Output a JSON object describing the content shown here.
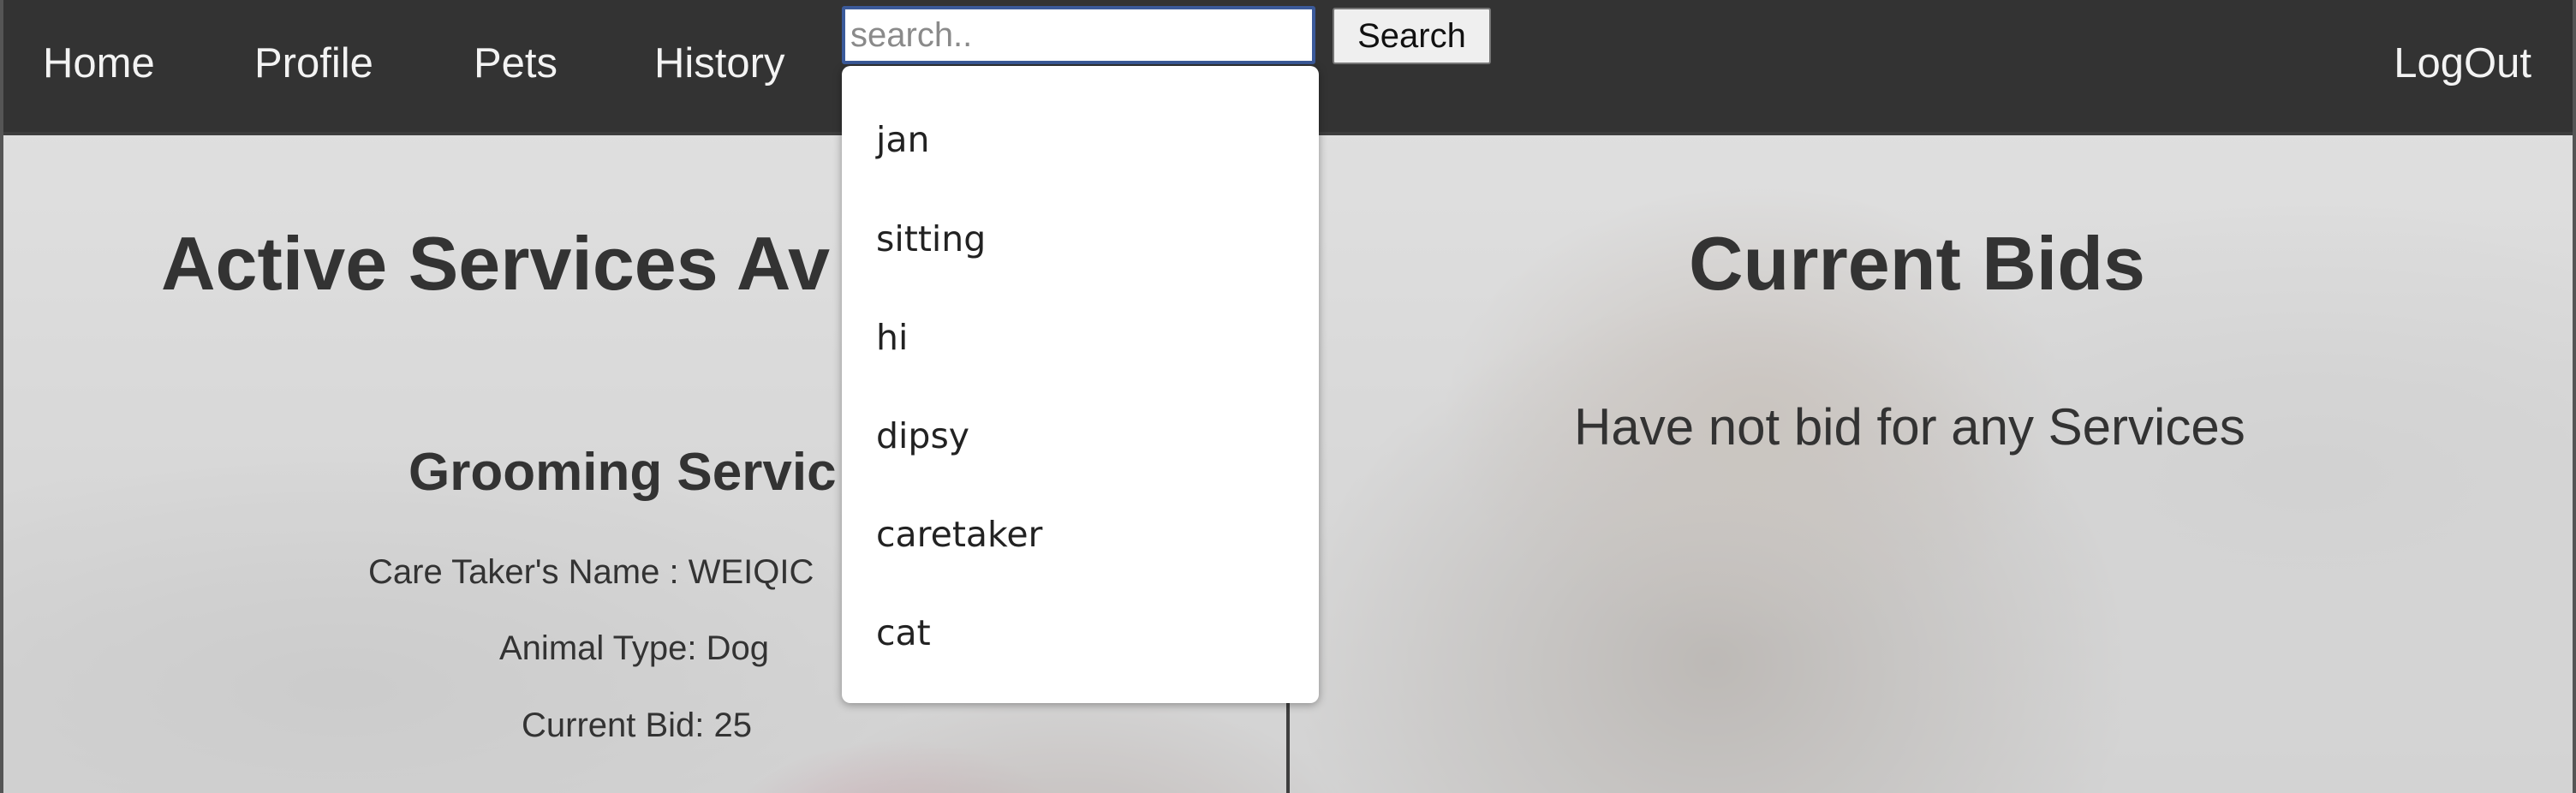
{
  "navbar": {
    "links": [
      "Home",
      "Profile",
      "Pets",
      "History"
    ],
    "logout_label": "LogOut"
  },
  "search": {
    "placeholder": "search..",
    "button_label": "Search",
    "suggestions": [
      "jan",
      "sitting",
      "hi",
      "dipsy",
      "caretaker",
      "cat"
    ]
  },
  "left_panel": {
    "heading": "Active Services Av",
    "service": {
      "title": "Grooming Servic",
      "caretaker": "Care Taker's Name : WEIQIC",
      "animal_type": "Animal Type: Dog",
      "current_bid": "Current Bid: 25"
    }
  },
  "right_panel": {
    "heading": "Current Bids",
    "empty_message": "Have not bid for any Services"
  },
  "colors": {
    "navbar_bg": "#333333",
    "nav_text": "#f3f3f3",
    "heading_text": "#333333",
    "search_focus_border": "#3b5a9a"
  }
}
